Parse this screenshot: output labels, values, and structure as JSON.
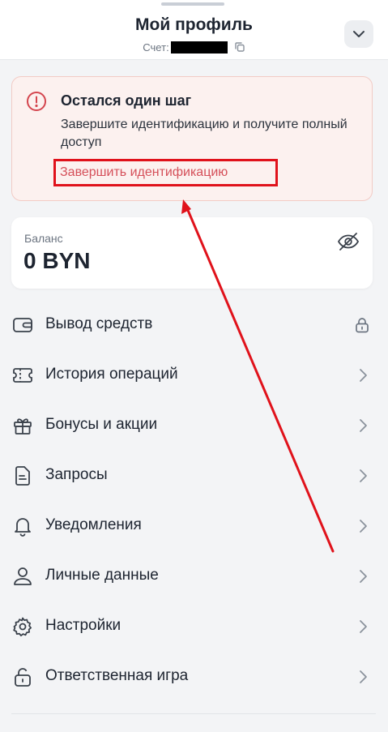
{
  "header": {
    "title": "Мой профиль",
    "account_label": "Счет:",
    "collapse_icon": "chevron-down-icon",
    "copy_icon": "copy-icon"
  },
  "alert": {
    "title": "Остался один шаг",
    "text": "Завершите идентификацию и получите полный доступ",
    "link": "Завершить идентификацию",
    "icon": "alert-circle-icon",
    "accent": "#e0121b"
  },
  "balance": {
    "label": "Баланс",
    "value": "0 BYN",
    "icon": "eye-off-icon"
  },
  "menu": {
    "items": [
      {
        "label": "Вывод средств",
        "icon": "wallet-icon",
        "trailing": "lock-icon"
      },
      {
        "label": "История операций",
        "icon": "ticket-icon",
        "trailing": "chevron-right-icon"
      },
      {
        "label": "Бонусы и акции",
        "icon": "gift-icon",
        "trailing": "chevron-right-icon"
      },
      {
        "label": "Запросы",
        "icon": "document-icon",
        "trailing": "chevron-right-icon"
      },
      {
        "label": "Уведомления",
        "icon": "bell-icon",
        "trailing": "chevron-right-icon"
      },
      {
        "label": "Личные данные",
        "icon": "user-icon",
        "trailing": "chevron-right-icon"
      },
      {
        "label": "Настройки",
        "icon": "gear-icon",
        "trailing": "chevron-right-icon"
      },
      {
        "label": "Ответственная игра",
        "icon": "unlock-icon",
        "trailing": "chevron-right-icon"
      }
    ]
  },
  "colors": {
    "background": "#f3f4f6",
    "alert_bg": "#fcf1ef",
    "link_text": "#d5505a",
    "annotation": "#e0121b"
  }
}
